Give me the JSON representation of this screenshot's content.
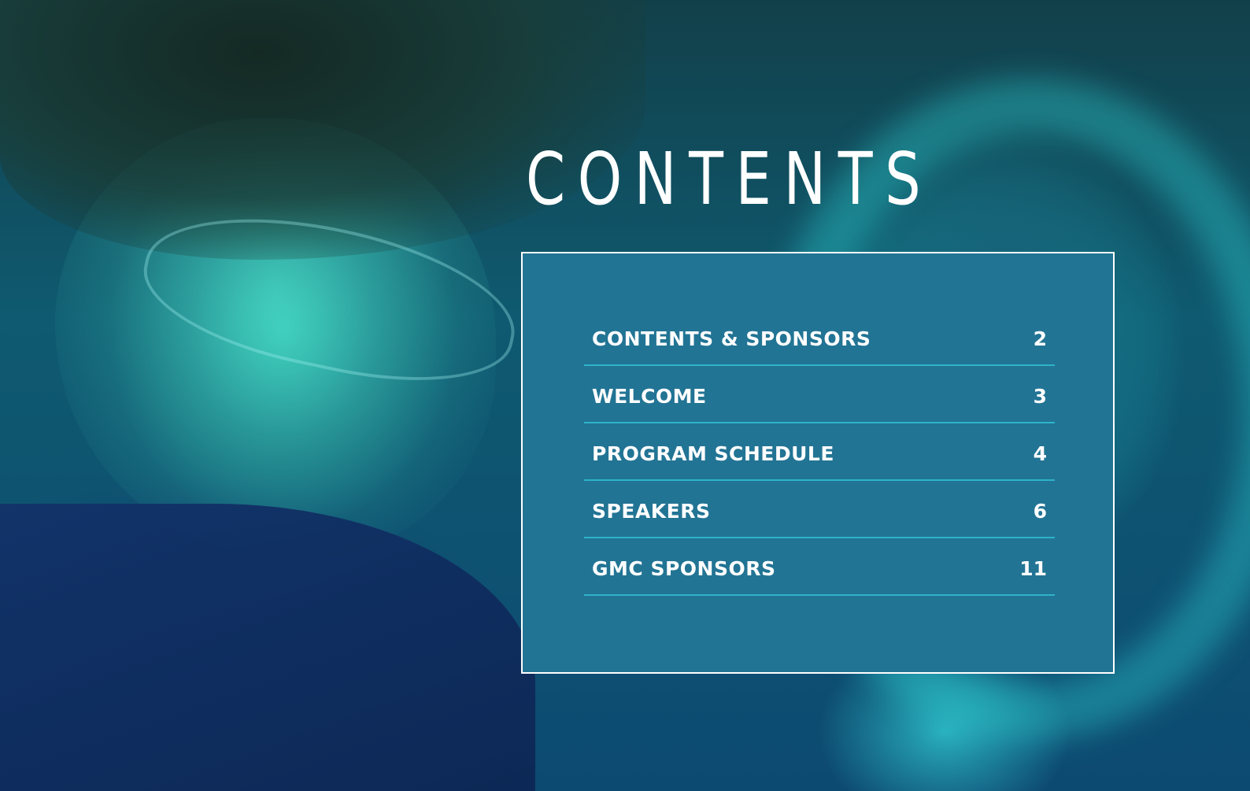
{
  "title": "CONTENTS",
  "toc": {
    "items": [
      {
        "label": "CONTENTS & SPONSORS",
        "page": "2"
      },
      {
        "label": "WELCOME",
        "page": "3"
      },
      {
        "label": "PROGRAM SCHEDULE",
        "page": "4"
      },
      {
        "label": "SPEAKERS",
        "page": "6"
      },
      {
        "label": "GMC SPONSORS",
        "page": "11"
      }
    ]
  },
  "colors": {
    "panel": "#227494",
    "divider": "#2fb3c9",
    "text": "#ffffff"
  }
}
